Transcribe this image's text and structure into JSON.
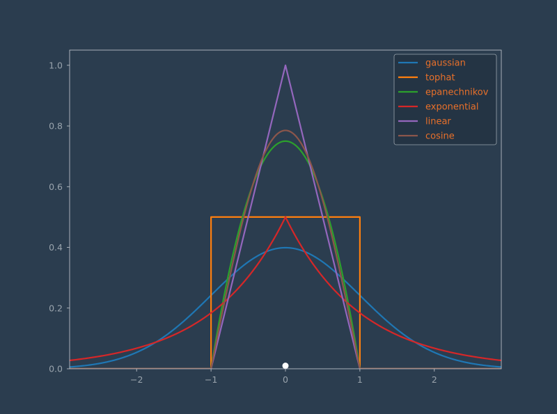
{
  "chart_data": {
    "type": "line",
    "title": "",
    "xlabel": "",
    "ylabel": "",
    "xlim": [
      -2.9,
      2.9
    ],
    "ylim": [
      0.0,
      1.05
    ],
    "xticks": [
      -2,
      -1,
      0,
      1,
      2
    ],
    "xtick_labels": [
      "−2",
      "−1",
      "0",
      "1",
      "2"
    ],
    "yticks": [
      0.0,
      0.2,
      0.4,
      0.6,
      0.8,
      1.0
    ],
    "ytick_labels": [
      "0.0",
      "0.2",
      "0.4",
      "0.6",
      "0.8",
      "1.0"
    ],
    "grid": false,
    "legend_position": "top-right",
    "bandwidth": 1,
    "sample_point": {
      "x": 0,
      "y": 0.01,
      "color": "#ffffff"
    },
    "series": [
      {
        "name": "gaussian",
        "kernel": "gaussian",
        "color": "#1f77b4",
        "x": [
          -2.9,
          -2.5,
          -2.0,
          -1.5,
          -1.0,
          -0.5,
          0.0,
          0.5,
          1.0,
          1.5,
          2.0,
          2.5,
          2.9
        ],
        "y": [
          0.006,
          0.018,
          0.054,
          0.13,
          0.242,
          0.352,
          0.399,
          0.352,
          0.242,
          0.13,
          0.054,
          0.018,
          0.006
        ]
      },
      {
        "name": "tophat",
        "kernel": "tophat",
        "color": "#ff7f0e",
        "x": [
          -2.9,
          -1.0,
          -1.0,
          1.0,
          1.0,
          2.9
        ],
        "y": [
          0.0,
          0.0,
          0.5,
          0.5,
          0.0,
          0.0
        ]
      },
      {
        "name": "epanechnikov",
        "kernel": "epanechnikov",
        "color": "#2ca02c",
        "x": [
          -2.9,
          -1.0,
          -0.75,
          -0.5,
          -0.25,
          0.0,
          0.25,
          0.5,
          0.75,
          1.0,
          2.9
        ],
        "y": [
          0.0,
          0.0,
          0.328,
          0.5625,
          0.703,
          0.75,
          0.703,
          0.5625,
          0.328,
          0.0,
          0.0
        ]
      },
      {
        "name": "exponential",
        "kernel": "exponential",
        "color": "#d62728",
        "x": [
          -2.9,
          -2.0,
          -1.5,
          -1.0,
          -0.5,
          0.0,
          0.5,
          1.0,
          1.5,
          2.0,
          2.9
        ],
        "y": [
          0.028,
          0.068,
          0.112,
          0.184,
          0.303,
          0.5,
          0.303,
          0.184,
          0.112,
          0.068,
          0.028
        ]
      },
      {
        "name": "linear",
        "kernel": "linear",
        "color": "#9467bd",
        "x": [
          -2.9,
          -1.0,
          0.0,
          1.0,
          2.9
        ],
        "y": [
          0.0,
          0.0,
          1.0,
          0.0,
          0.0
        ]
      },
      {
        "name": "cosine",
        "kernel": "cosine",
        "color": "#8c564b",
        "x": [
          -2.9,
          -1.0,
          -0.75,
          -0.5,
          -0.25,
          0.0,
          0.25,
          0.5,
          0.75,
          1.0,
          2.9
        ],
        "y": [
          0.0,
          0.0,
          0.301,
          0.555,
          0.726,
          0.785,
          0.726,
          0.555,
          0.301,
          0.0,
          0.0
        ]
      }
    ]
  }
}
